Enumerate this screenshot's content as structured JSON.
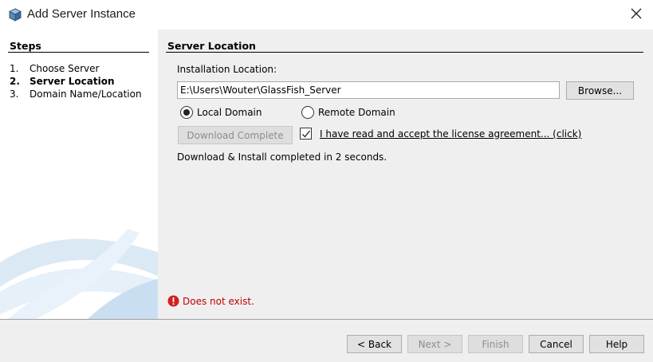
{
  "window": {
    "title": "Add Server Instance",
    "app_icon": "cube-icon",
    "close_icon": "close-icon"
  },
  "steps": {
    "heading": "Steps",
    "items": [
      {
        "number": "1.",
        "label": "Choose Server",
        "current": false
      },
      {
        "number": "2.",
        "label": "Server Location",
        "current": true
      },
      {
        "number": "3.",
        "label": "Domain Name/Location",
        "current": false
      }
    ]
  },
  "main": {
    "section_title": "Server Location",
    "installation_label": "Installation Location:",
    "installation_path": "E:\\Users\\Wouter\\GlassFish_Server",
    "browse_label": "Browse...",
    "local_domain_label": "Local Domain",
    "local_domain_selected": true,
    "remote_domain_label": "Remote Domain",
    "remote_domain_selected": false,
    "download_label": "Download Complete",
    "license_checked": true,
    "license_label": "I have read and accept the license agreement... (click)",
    "status_message": "Download & Install completed in 2 seconds.",
    "error_message": "Does not exist.",
    "error_icon": "error-icon"
  },
  "footer": {
    "back_label": "< Back",
    "next_label": "Next >",
    "finish_label": "Finish",
    "cancel_label": "Cancel",
    "help_label": "Help"
  },
  "colors": {
    "content_background": "#efefef",
    "error_text": "#c30000",
    "error_icon": "#d32020",
    "disabled_text": "#8d8d8d"
  }
}
